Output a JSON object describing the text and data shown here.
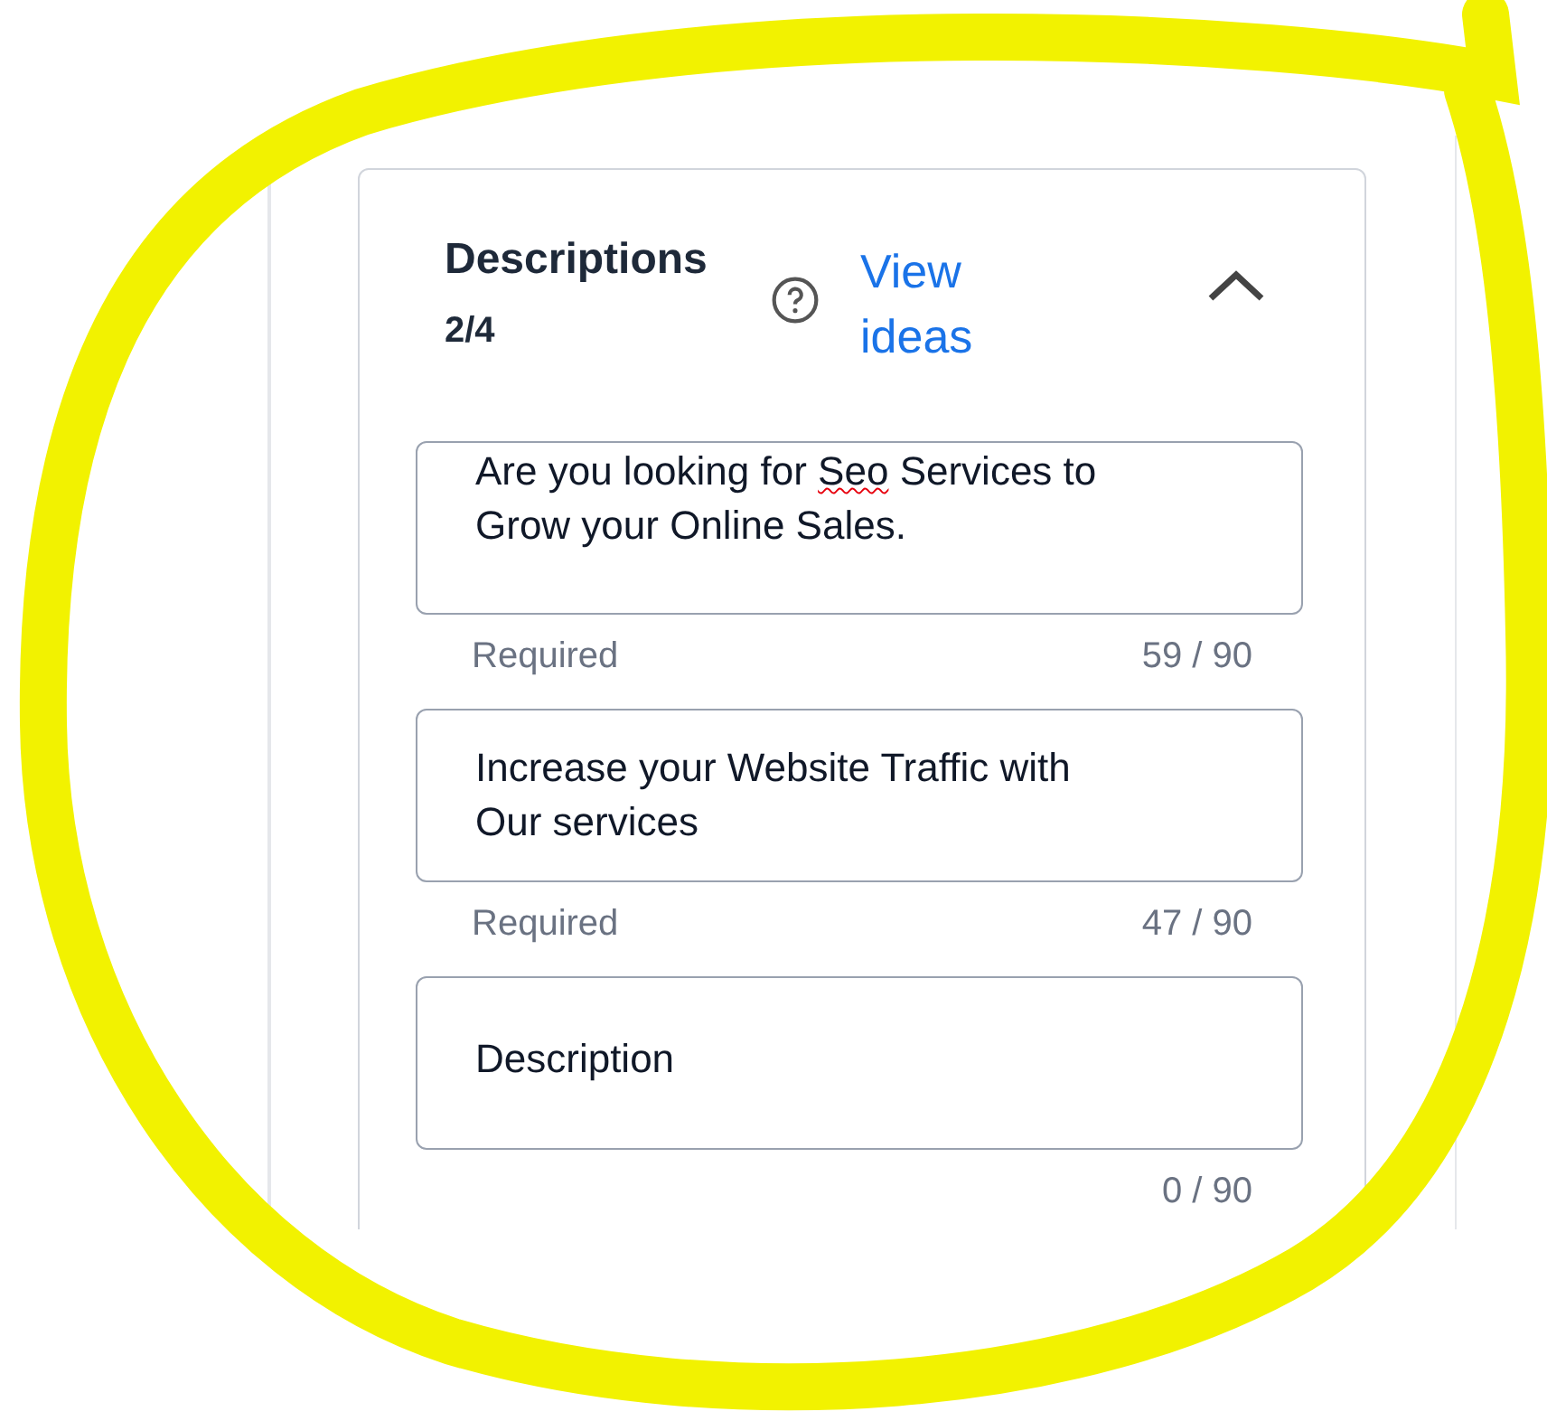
{
  "section": {
    "title": "Descriptions",
    "count": "2/4",
    "link": "View ideas",
    "expanded": true
  },
  "fields": [
    {
      "segments": [
        {
          "text": "Are you looking for ",
          "misspelled": false
        },
        {
          "text": "Seo",
          "misspelled": true
        },
        {
          "text": " Services to Grow your Online Sales.",
          "misspelled": false
        }
      ],
      "helper": "Required",
      "counter": "59 / 90"
    },
    {
      "segments": [
        {
          "text": "Increase your Website Traffic with Our services",
          "misspelled": false
        }
      ],
      "helper": "Required",
      "counter": "47 / 90"
    },
    {
      "placeholder": "Description",
      "counter": "0 / 90"
    }
  ]
}
